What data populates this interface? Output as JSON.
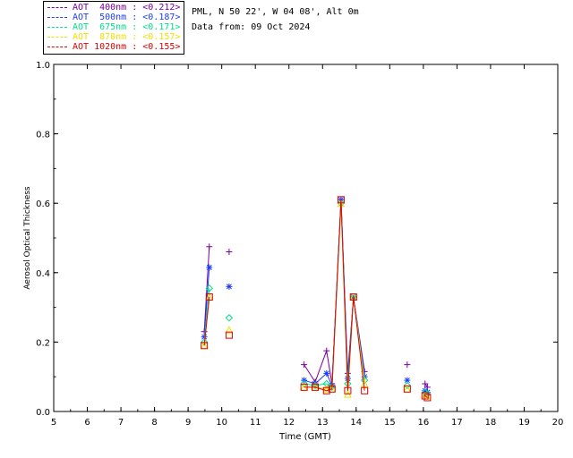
{
  "header": {
    "site": "PML, N 50 22', W 04 08', Alt 0m",
    "date": "Data from: 09 Oct 2024"
  },
  "legend": [
    {
      "label": "AOT  400nm : <0.212>",
      "color": "#7a00a0"
    },
    {
      "label": "AOT  500nm : <0.187>",
      "color": "#1a3cff"
    },
    {
      "label": "AOT  675nm : <0.171>",
      "color": "#00e08a"
    },
    {
      "label": "AOT  870nm : <0.157>",
      "color": "#f0e000"
    },
    {
      "label": "AOT 1020nm : <0.155>",
      "color": "#e00000"
    }
  ],
  "chart_data": {
    "type": "scatter",
    "xlabel": "Time (GMT)",
    "ylabel": "Aerosol Optical Thickness",
    "xlim": [
      5,
      20
    ],
    "ylim": [
      0,
      1
    ],
    "xticks": [
      5,
      6,
      7,
      8,
      9,
      10,
      11,
      12,
      13,
      14,
      15,
      16,
      17,
      18,
      19,
      20
    ],
    "yticks": [
      "0.0",
      "0.2",
      "0.4",
      "0.6",
      "0.8",
      "1.0"
    ],
    "grid": false,
    "legend_position": "top-left",
    "series": [
      {
        "name": "AOT  400nm",
        "color": "#7a00a0",
        "marker": "plus",
        "x": [
          9.48,
          9.63,
          10.22,
          12.45,
          12.78,
          13.12,
          13.28,
          13.55,
          13.75,
          13.92,
          14.25,
          15.52,
          16.05,
          16.12
        ],
        "y": [
          0.23,
          0.475,
          0.46,
          0.135,
          0.085,
          0.175,
          0.08,
          0.61,
          0.11,
          0.33,
          0.115,
          0.135,
          0.08,
          0.07
        ]
      },
      {
        "name": "AOT  500nm",
        "color": "#1a3cff",
        "marker": "star",
        "x": [
          9.48,
          9.63,
          10.22,
          12.45,
          12.78,
          13.12,
          13.28,
          13.55,
          13.75,
          13.92,
          14.25,
          15.52,
          16.05,
          16.12
        ],
        "y": [
          0.215,
          0.415,
          0.36,
          0.09,
          0.08,
          0.11,
          0.075,
          0.61,
          0.095,
          0.33,
          0.1,
          0.09,
          0.06,
          0.055
        ]
      },
      {
        "name": "AOT  675nm",
        "color": "#00e08a",
        "marker": "diamond",
        "x": [
          9.48,
          9.63,
          10.22,
          12.45,
          12.78,
          13.12,
          13.28,
          13.55,
          13.75,
          13.92,
          14.25,
          15.52,
          16.05,
          16.12
        ],
        "y": [
          0.2,
          0.355,
          0.27,
          0.08,
          0.075,
          0.08,
          0.07,
          0.6,
          0.08,
          0.33,
          0.09,
          0.075,
          0.055,
          0.05
        ]
      },
      {
        "name": "AOT  870nm",
        "color": "#f0e000",
        "marker": "triangle",
        "x": [
          9.48,
          9.63,
          10.22,
          12.45,
          12.78,
          13.12,
          13.28,
          13.55,
          13.75,
          13.92,
          14.25,
          15.52,
          16.05,
          16.12
        ],
        "y": [
          0.19,
          0.33,
          0.235,
          0.07,
          0.07,
          0.065,
          0.065,
          0.6,
          0.05,
          0.33,
          0.08,
          0.065,
          0.045,
          0.04
        ]
      },
      {
        "name": "AOT 1020nm",
        "color": "#e00000",
        "marker": "square",
        "x": [
          9.48,
          9.63,
          10.22,
          12.45,
          12.78,
          13.12,
          13.28,
          13.55,
          13.75,
          13.92,
          14.25,
          15.52,
          16.05,
          16.12
        ],
        "y": [
          0.19,
          0.33,
          0.22,
          0.07,
          0.07,
          0.06,
          0.065,
          0.61,
          0.06,
          0.33,
          0.06,
          0.065,
          0.045,
          0.04
        ]
      }
    ]
  }
}
